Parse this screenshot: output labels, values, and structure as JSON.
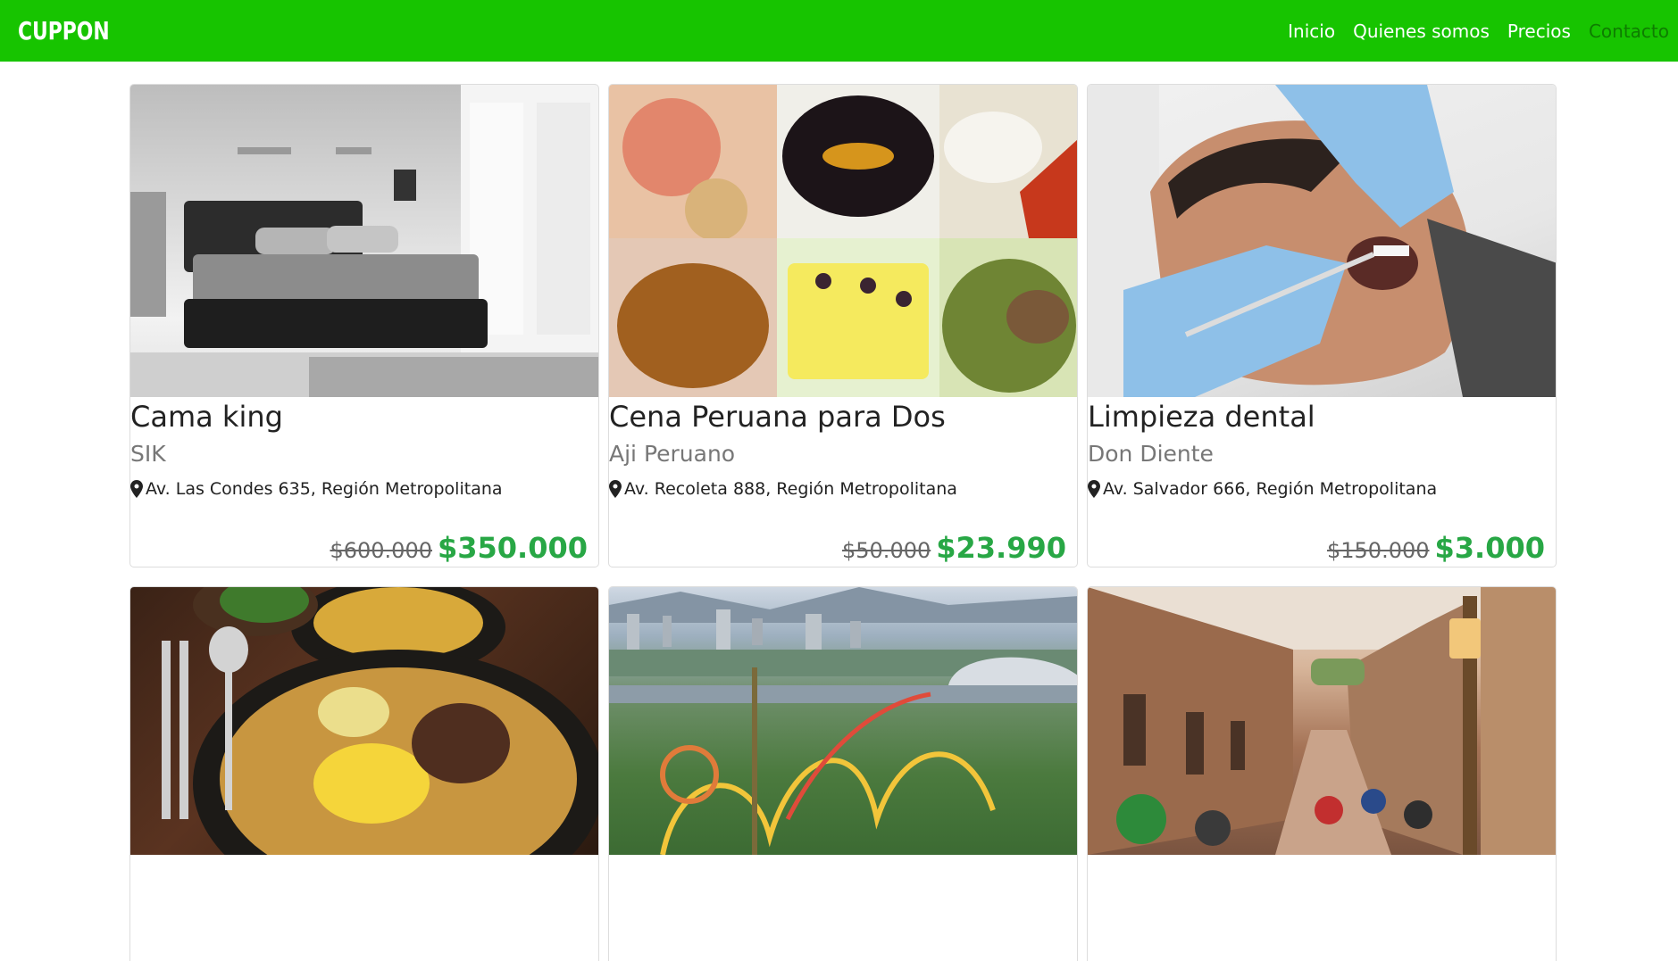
{
  "navbar": {
    "brand": "CUPPON",
    "links": [
      "Inicio",
      "Quienes somos",
      "Precios",
      "Contacto"
    ]
  },
  "cards": [
    {
      "title": "Cama king",
      "subtitle": "SIK",
      "address": "Av. Las Condes 635, Región Metropolitana",
      "old_price": "$600.000",
      "new_price": "$350.000"
    },
    {
      "title": "Cena Peruana para Dos",
      "subtitle": "Aji Peruano",
      "address": " Av. Recoleta 888, Región Metropolitana",
      "old_price": "$50.000",
      "new_price": "$23.990"
    },
    {
      "title": "Limpieza dental",
      "subtitle": "Don Diente",
      "address": "Av. Salvador 666, Región Metropolitana",
      "old_price": "$150.000",
      "new_price": "$3.000"
    }
  ],
  "colors": {
    "navbar_bg": "#17c400",
    "price_green": "#28a745"
  }
}
